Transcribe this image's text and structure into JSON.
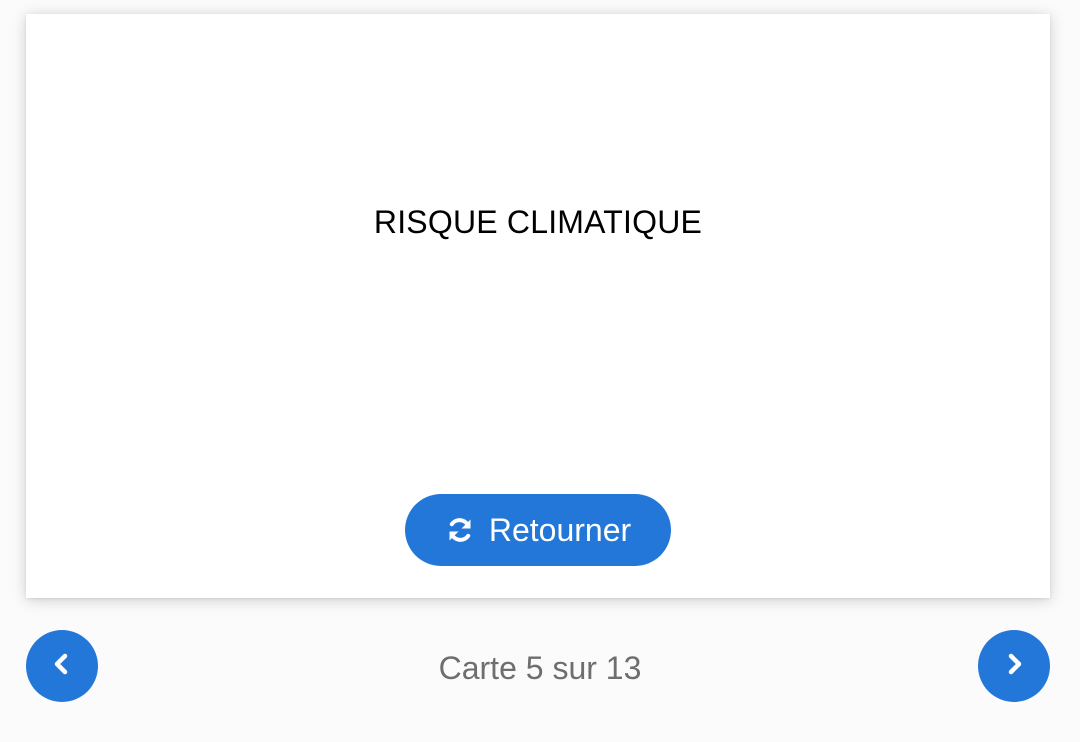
{
  "card": {
    "term": "RISQUE CLIMATIQUE"
  },
  "flip_button": {
    "label": "Retourner",
    "icon": "sync-icon"
  },
  "navigation": {
    "prev_icon": "chevron-left-icon",
    "next_icon": "chevron-right-icon",
    "counter_text": "Carte 5 sur 13"
  },
  "colors": {
    "accent": "#2377d8",
    "counter_text": "#6e6e6e",
    "background": "#fbfbfb"
  }
}
